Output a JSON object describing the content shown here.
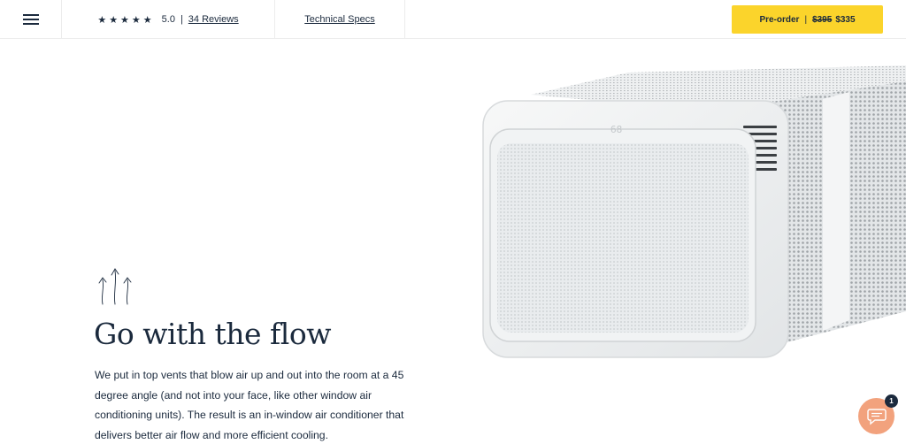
{
  "header": {
    "rating": {
      "stars": "★★★★★",
      "score": "5.0",
      "separator": "|",
      "reviews_label": "34 Reviews"
    },
    "specs_label": "Technical Specs",
    "preorder": {
      "label": "Pre-order",
      "separator": "|",
      "old_price": "$395",
      "new_price": "$335",
      "color": "#fbd42b"
    }
  },
  "product": {
    "display_reading": "68"
  },
  "main": {
    "icon": "airflow-arrows-icon",
    "headline": "Go with the flow",
    "body": "We put in top vents that blow air up and out into the room at a 45 degree angle (and not into your face, like other window air conditioning units). The result is an in-window air conditioner that delivers better air flow and more efficient cooling."
  },
  "chat": {
    "icon": "chat-bubble-icon",
    "badge_count": "1",
    "color": "#f2a27d"
  }
}
